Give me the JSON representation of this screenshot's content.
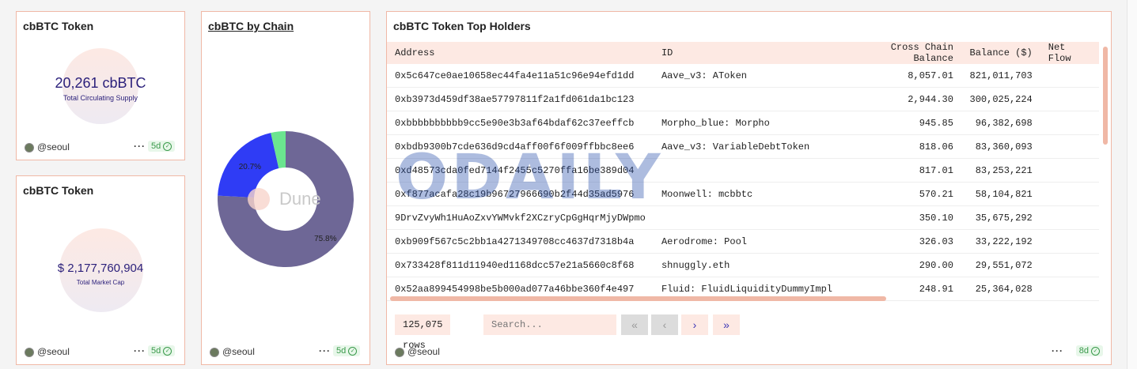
{
  "supply_panel": {
    "title": "cbBTC Token",
    "value": "20,261 cbBTC",
    "label": "Total Circulating Supply",
    "author": "@seoul",
    "age": "5d"
  },
  "marketcap_panel": {
    "title": "cbBTC Token",
    "value": "$ 2,177,760,904",
    "label": "Total Market Cap",
    "author": "@seoul",
    "age": "5d"
  },
  "chain_panel": {
    "title": "cbBTC by Chain",
    "watermark": "Dune",
    "author": "@seoul",
    "age": "5d"
  },
  "chart_data": {
    "type": "pie",
    "variant": "donut",
    "slices": [
      {
        "value": 75.8,
        "label": "75.8%",
        "color": "#6e6796"
      },
      {
        "value": 20.7,
        "label": "20.7%",
        "color": "#2f3cf5"
      },
      {
        "value": 3.5,
        "label": "",
        "color": "#6be58f"
      }
    ]
  },
  "holders_panel": {
    "title": "cbBTC Token Top Holders",
    "columns": [
      "Address",
      "ID",
      "Cross Chain Balance",
      "Balance ($)",
      "Net Flow"
    ],
    "rows": [
      [
        "0x5c647ce0ae10658ec44fa4e11a51c96e94efd1dd",
        "Aave_v3: AToken",
        "8,057.01",
        "821,011,703",
        ""
      ],
      [
        "0xb3973d459df38ae57797811f2a1fd061da1bc123",
        "",
        "2,944.30",
        "300,025,224",
        ""
      ],
      [
        "0xbbbbbbbbbb9cc5e90e3b3af64bdaf62c37eeffcb",
        "Morpho_blue: Morpho",
        "945.85",
        "96,382,698",
        ""
      ],
      [
        "0xbdb9300b7cde636d9cd4aff00f6f009ffbbc8ee6",
        "Aave_v3: VariableDebtToken",
        "818.06",
        "83,360,093",
        ""
      ],
      [
        "0xd48573cda0fed7144f2455c5270ffa16be389d04",
        "",
        "817.01",
        "83,253,221",
        ""
      ],
      [
        "0xf877acafa28c19b96727966690b2f44d35ad5976",
        "Moonwell: mcbbtc",
        "570.21",
        "58,104,821",
        ""
      ],
      [
        "9DrvZvyWh1HuAoZxvYWMvkf2XCzryCpGgHqrMjyDWpmo",
        "",
        "350.10",
        "35,675,292",
        ""
      ],
      [
        "0xb909f567c5c2bb1a4271349708cc4637d7318b4a",
        "Aerodrome: Pool",
        "326.03",
        "33,222,192",
        ""
      ],
      [
        "0x733428f811d11940ed1168dcc57e21a5660c8f68",
        "shnuggly.eth",
        "290.00",
        "29,551,072",
        ""
      ],
      [
        "0x52aa899454998be5b000ad077a46bbe360f4e497",
        "Fluid: FluidLiquidityDummyImpl",
        "248.91",
        "25,364,028",
        ""
      ]
    ],
    "row_count": "125,075 rows",
    "search_placeholder": "Search...",
    "author": "@seoul",
    "age": "8d"
  },
  "watermark_text": "ODAILY",
  "icons": [
    "avatar",
    "more-dots-icon",
    "check-circle-icon",
    "first-page-icon",
    "prev-page-icon",
    "next-page-icon",
    "last-page-icon"
  ],
  "colors": {
    "accent": "#f0b8a6",
    "header_bg": "#fde9e3",
    "value_text": "#2a1f7a",
    "age_green": "#3a9a4b"
  }
}
